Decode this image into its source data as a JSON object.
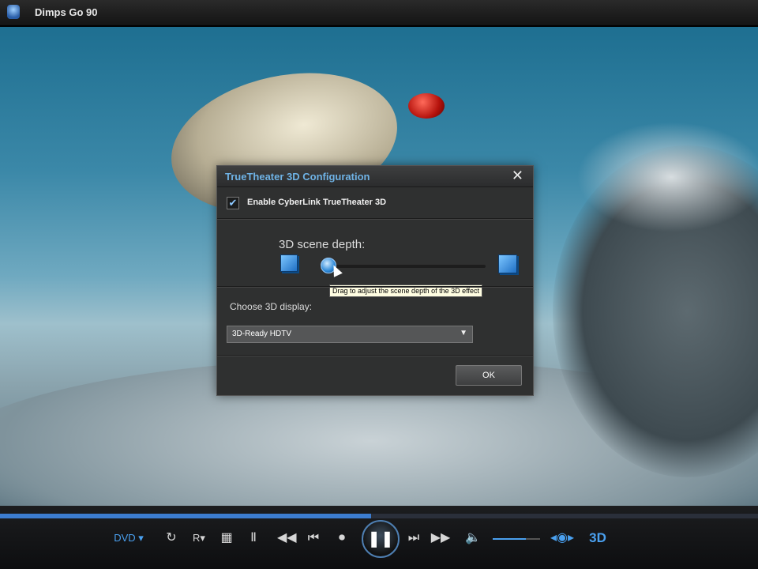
{
  "window": {
    "title": "Dimps Go 90",
    "app_icon": "app-logo-icon"
  },
  "dialog": {
    "title": "TrueTheater 3D Configuration",
    "close_glyph": "✕",
    "enable_checkbox": {
      "label": "Enable CyberLink TrueTheater 3D",
      "checked": true
    },
    "scene_depth": {
      "label": "3D scene depth:",
      "tooltip": "Drag to adjust the scene depth of the 3D effect",
      "value_fraction": 0.05
    },
    "choose_display": {
      "label": "Choose 3D display:",
      "selected": "3D-Ready HDTV"
    },
    "ok_label": "OK"
  },
  "player": {
    "progress_fraction": 0.49,
    "volume_fraction": 0.7,
    "source_label": "DVD",
    "mode_label": "3D",
    "icons": [
      "repeat-icon",
      "ratio-icon",
      "menu-grid-icon",
      "subtitle-icon",
      "rewind-icon",
      "previous-icon",
      "stop-icon",
      "pause-icon",
      "next-icon",
      "fast-forward-icon",
      "volume-icon",
      "3d-toggle-icon"
    ]
  },
  "colors": {
    "accent": "#4aa0ef",
    "dialog_title": "#6fb3e6"
  }
}
